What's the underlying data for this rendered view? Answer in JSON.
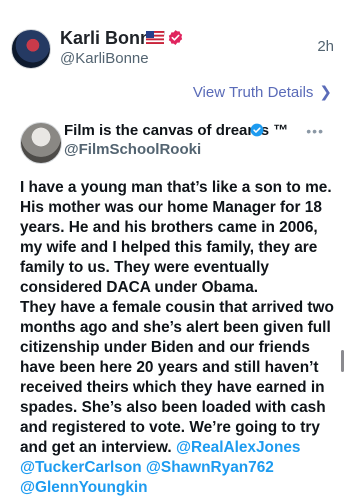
{
  "post": {
    "display_name": "Karli Bonne'",
    "handle": "@KarliBonne",
    "timestamp": "2h",
    "flag_icon": "us-flag-icon",
    "verified_icon": "verified-badge-icon",
    "verified_color": "#e0245e"
  },
  "view_details": {
    "label": "View Truth Details",
    "icon": "chevron-right-icon",
    "color": "#5a6bb8"
  },
  "quote": {
    "display_name": "Film is the canvas of dreams ™",
    "handle": "@FilmSchoolRooki",
    "verified_color": "#1d9bf0",
    "more_icon": "more-dots-icon",
    "paragraph1": "I have a young man that’s like a son to me. His mother was our home Manager for 18 years. He and his brothers came in 2006, my wife and I helped this family, they are family to us. They were eventually considered DACA under Obama.",
    "paragraph2": "They have a female cousin that arrived two months ago and she’s alert been given full citizenship under Biden and our friends have been here 20 years and still haven’t received theirs which they have earned in spades. She’s also been loaded with cash and registered to vote. We’re going to try and get an interview.",
    "mentions": [
      "@RealAlexJones",
      "@TuckerCarlson",
      "@ShawnRyan762",
      "@GlennYoungkin"
    ],
    "mention_color": "#1d9bf0"
  }
}
